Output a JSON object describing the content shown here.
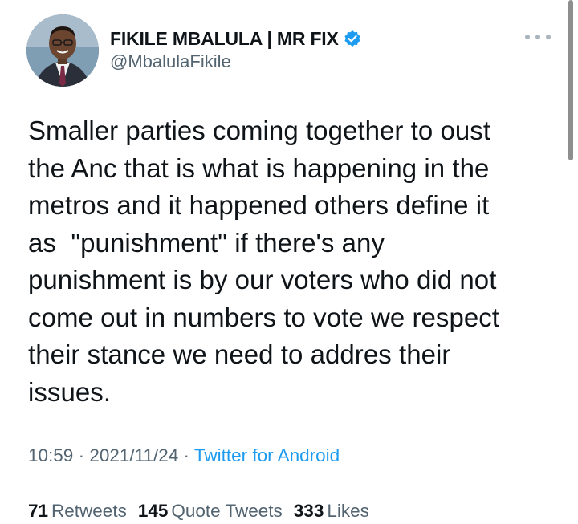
{
  "author": {
    "display_name": "FIKILE MBALULA | MR FIX",
    "handle": "@MbalulaFikile",
    "verified_icon": "verified-badge-icon",
    "more_icon": "more-options-icon"
  },
  "tweet": {
    "lines": [
      "Smaller parties coming together to oust",
      "the Anc that is what is happening in the",
      "metros and it happened others define it",
      "as  \"punishment\" if there's any",
      "punishment is by our voters who did not",
      "come out in numbers to vote we respect",
      "their stance we need to addres their",
      "issues."
    ]
  },
  "meta": {
    "time": "10:59",
    "separator": " · ",
    "date": "2021/11/24",
    "source": "Twitter for Android"
  },
  "stats": {
    "retweets_count": "71",
    "retweets_label": "Retweets",
    "quotes_count": "145",
    "quotes_label": "Quote Tweets",
    "likes_count": "333",
    "likes_label": "Likes"
  },
  "colors": {
    "text": "#0f1419",
    "secondary": "#536471",
    "accent": "#1d9bf0"
  }
}
